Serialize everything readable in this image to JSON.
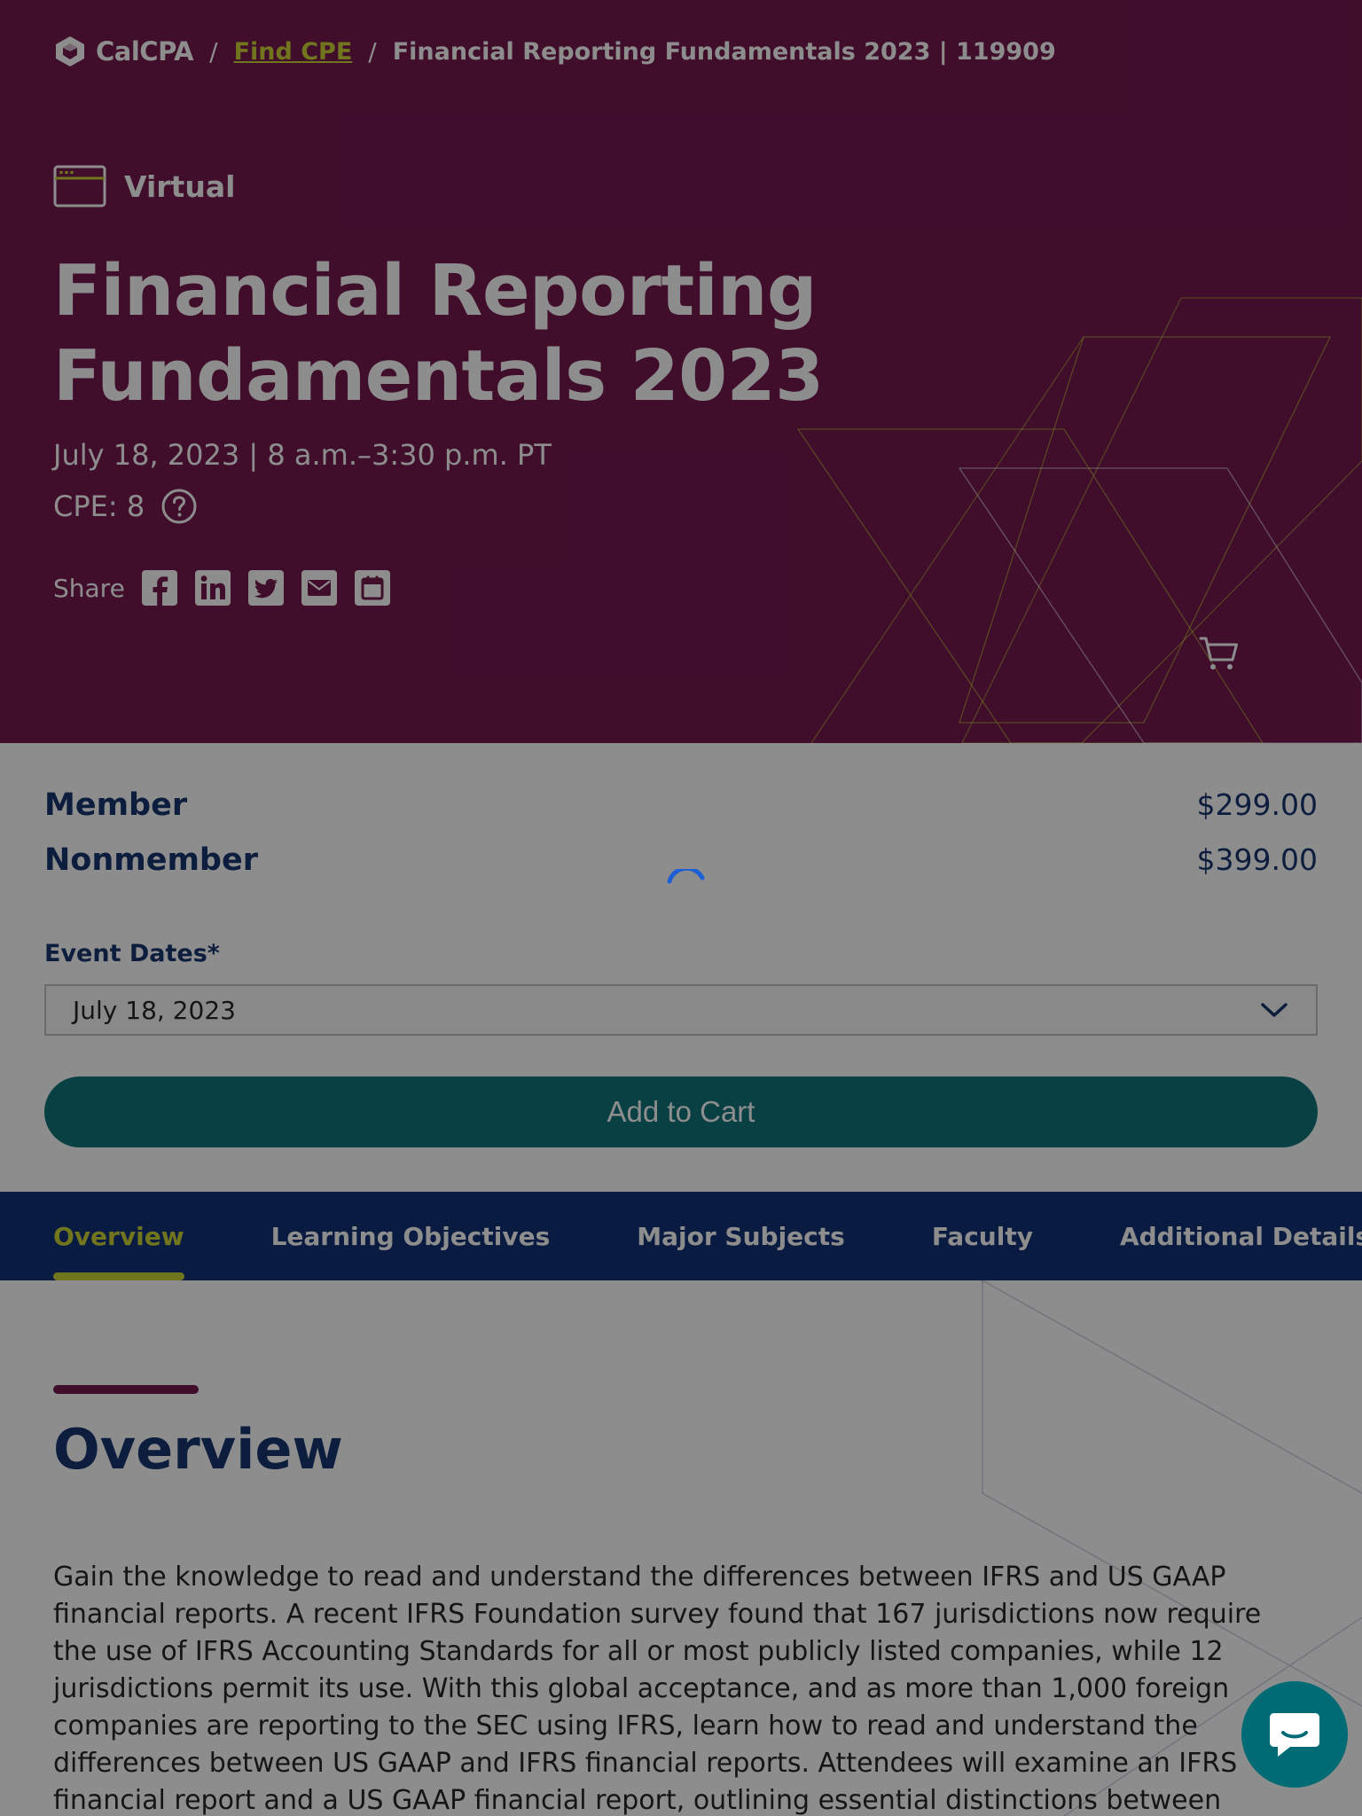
{
  "breadcrumb": {
    "logo_text": "CalCPA",
    "separator": "/",
    "link": "Find CPE",
    "current": "Financial Reporting Fundamentals 2023 | 119909"
  },
  "event": {
    "format": "Virtual",
    "title": "Financial Reporting Fundamentals 2023",
    "date_time": "July 18, 2023 | 8 a.m.–3:30 p.m. PT",
    "cpe": "CPE: 8",
    "share_label": "Share",
    "share_icons": [
      "facebook-icon",
      "linkedin-icon",
      "twitter-icon",
      "email-icon",
      "calendar-icon"
    ]
  },
  "pricing": {
    "member_label": "Member",
    "member_price": "$299.00",
    "nonmember_label": "Nonmember",
    "nonmember_price": "$399.00",
    "event_dates_label": "Event Dates*",
    "selected_date": "July 18, 2023",
    "add_to_cart": "Add to Cart"
  },
  "tabs": [
    {
      "label": "Overview",
      "active": true
    },
    {
      "label": "Learning Objectives",
      "active": false
    },
    {
      "label": "Major Subjects",
      "active": false
    },
    {
      "label": "Faculty",
      "active": false
    },
    {
      "label": "Additional Details",
      "active": false
    }
  ],
  "overview": {
    "heading": "Overview",
    "body": "Gain the knowledge to read and understand the differences between IFRS and US GAAP financial reports. A recent IFRS Foundation survey found that 167 jurisdictions now require the use of IFRS Accounting Standards for all or most publicly listed companies, while 12 jurisdictions permit its use. With this global acceptance, and as more than 1,000 foreign companies are reporting to the SEC using IFRS, learn how to read and understand the differences between US GAAP and IFRS financial reports. Attendees will examine an IFRS financial report and a US GAAP financial report, outlining essential distinctions between"
  },
  "colors": {
    "hero_bg": "#6b0a44",
    "accent_lime": "#c8d22b",
    "navy": "#04266e",
    "teal": "#006b74"
  },
  "state": {
    "loading": true
  }
}
